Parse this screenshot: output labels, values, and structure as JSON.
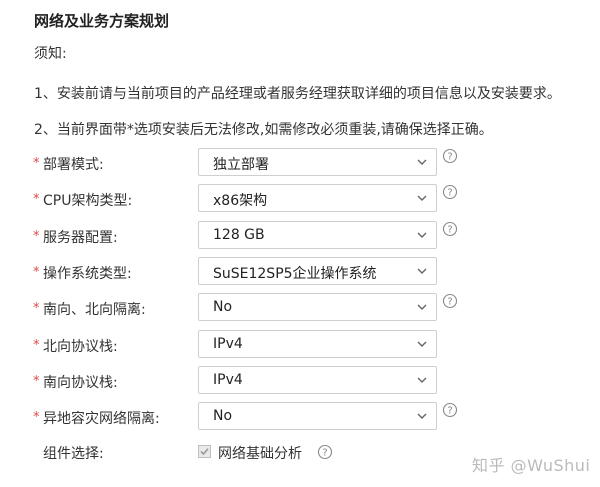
{
  "section_title": "网络及业务方案规划",
  "notes": {
    "heading": "须知:",
    "line1": "1、安装前请与当前项目的产品经理或者服务经理获取详细的项目信息以及安装要求。",
    "line2": "2、当前界面带*选项安装后无法修改,如需修改必须重装,请确保选择正确。"
  },
  "form": {
    "required_mark": "*",
    "fields": [
      {
        "label": "部署模式:",
        "value": "独立部署",
        "help_icon": "question-circle-icon"
      },
      {
        "label": "CPU架构类型:",
        "value": "x86架构",
        "help_icon": "question-circle-icon"
      },
      {
        "label": "服务器配置:",
        "value": "128 GB",
        "help_icon": "question-circle-icon"
      },
      {
        "label": "操作系统类型:",
        "value": "SuSE12SP5企业操作系统"
      },
      {
        "label": "南向、北向隔离:",
        "value": "No",
        "help_icon": "question-circle-icon"
      },
      {
        "label": "北向协议栈:",
        "value": "IPv4"
      },
      {
        "label": "南向协议栈:",
        "value": "IPv4"
      },
      {
        "label": "异地容灾网络隔离:",
        "value": "No",
        "help_icon": "question-circle-icon"
      }
    ],
    "component": {
      "label": "组件选择:",
      "option_label": "网络基础分析",
      "checked": true,
      "disabled": true
    }
  },
  "watermark": "知乎 @WuShui",
  "colors": {
    "required": "#e04848",
    "border": "#cfcfcf",
    "icon": "#888888"
  }
}
